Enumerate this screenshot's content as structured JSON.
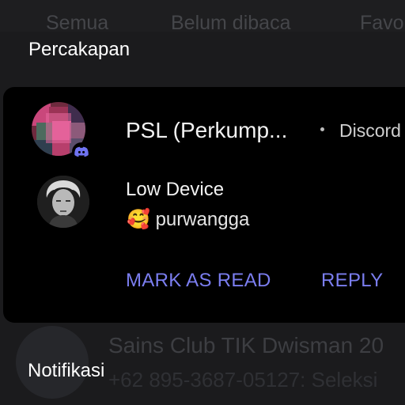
{
  "tabs": [
    "Semua",
    "Belum dibaca",
    "Favo"
  ],
  "section_title": "Percakapan",
  "notification": {
    "group_title": "PSL (Perkump...",
    "app_name": "Discord",
    "app_icon": "discord-icon",
    "sender": "Low Device",
    "message_emoji": "🥰",
    "message_text": "purwangga",
    "actions": {
      "mark_read": "MARK AS READ",
      "reply": "REPLY"
    },
    "accent_color": "#7b7ef0"
  },
  "background_item": {
    "title": "Sains Club TIK Dwisman 20",
    "subtitle": "+62 895-3687-05127: Seleksi"
  },
  "bottom_label": "Notifikasi"
}
